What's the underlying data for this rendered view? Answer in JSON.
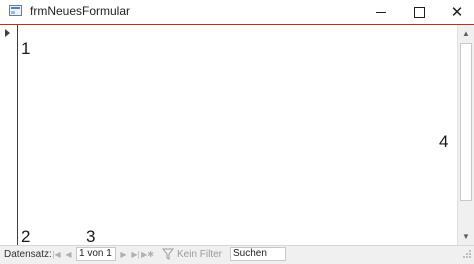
{
  "window": {
    "title": "frmNeuesFormular",
    "controls": {
      "minimize": "minimize-icon",
      "maximize": "maximize-icon",
      "close": "close-icon"
    }
  },
  "annotations": [
    "1",
    "2",
    "3",
    "4"
  ],
  "navigation": {
    "label": "Datensatz:",
    "current_record": "1 von 1",
    "filter_label": "Kein Filter",
    "search_label": "Suchen"
  },
  "colors": {
    "title_border": "#c42b1c",
    "background": "#ffffff",
    "navbar": "#f0f0f0"
  }
}
